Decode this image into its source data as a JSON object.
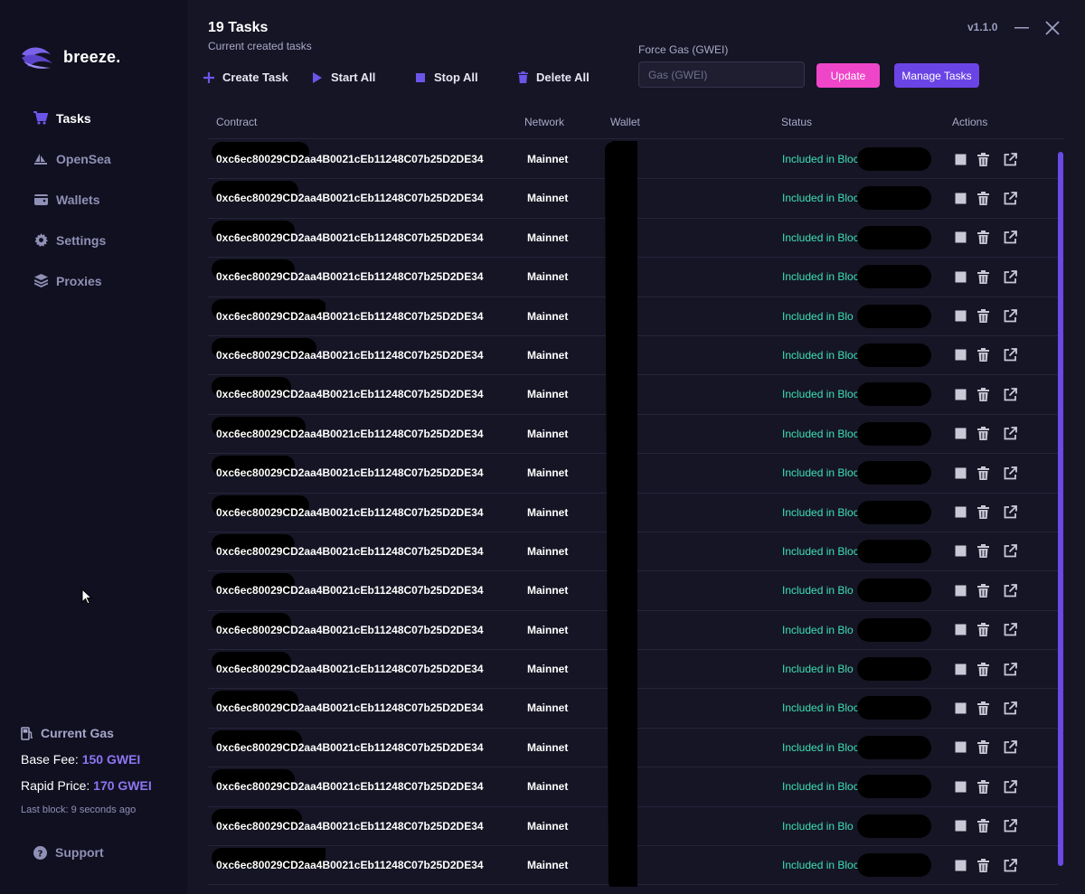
{
  "app": {
    "brand": "breeze.",
    "version": "v1.1.0"
  },
  "sidebar": {
    "items": [
      {
        "label": "Tasks",
        "icon": "cart-icon",
        "active": true
      },
      {
        "label": "OpenSea",
        "icon": "sailboat-icon",
        "active": false
      },
      {
        "label": "Wallets",
        "icon": "wallet-icon",
        "active": false
      },
      {
        "label": "Settings",
        "icon": "gear-icon",
        "active": false
      },
      {
        "label": "Proxies",
        "icon": "layers-icon",
        "active": false
      }
    ],
    "gas": {
      "title": "Current Gas",
      "base_fee_label": "Base Fee:",
      "base_fee_value": "150 GWEI",
      "rapid_label": "Rapid Price:",
      "rapid_value": "170 GWEI",
      "last_block": "Last block: 9 seconds ago"
    },
    "support_label": "Support"
  },
  "header": {
    "title": "19 Tasks",
    "subtitle": "Current created tasks"
  },
  "toolbar": {
    "create": "Create Task",
    "start": "Start All",
    "stop": "Stop All",
    "delete": "Delete All"
  },
  "gas_control": {
    "label": "Force Gas (GWEI)",
    "placeholder": "Gas (GWEI)",
    "value": "",
    "update_label": "Update",
    "manage_label": "Manage Tasks"
  },
  "table": {
    "columns": [
      "Contract",
      "Network",
      "Wallet",
      "Status",
      "Actions"
    ],
    "rows": [
      {
        "contract": "0xc6ec80029CD2aa4B0021cEb11248C07b25D2DE34",
        "network": "Mainnet",
        "status": "Included in Bloc"
      },
      {
        "contract": "0xc6ec80029CD2aa4B0021cEb11248C07b25D2DE34",
        "network": "Mainnet",
        "status": "Included in Bloc"
      },
      {
        "contract": "0xc6ec80029CD2aa4B0021cEb11248C07b25D2DE34",
        "network": "Mainnet",
        "status": "Included in Bloc"
      },
      {
        "contract": "0xc6ec80029CD2aa4B0021cEb11248C07b25D2DE34",
        "network": "Mainnet",
        "status": "Included in Bloc"
      },
      {
        "contract": "0xc6ec80029CD2aa4B0021cEb11248C07b25D2DE34",
        "network": "Mainnet",
        "status": "Included in Blo"
      },
      {
        "contract": "0xc6ec80029CD2aa4B0021cEb11248C07b25D2DE34",
        "network": "Mainnet",
        "status": "Included in Bloc"
      },
      {
        "contract": "0xc6ec80029CD2aa4B0021cEb11248C07b25D2DE34",
        "network": "Mainnet",
        "status": "Included in Bloc"
      },
      {
        "contract": "0xc6ec80029CD2aa4B0021cEb11248C07b25D2DE34",
        "network": "Mainnet",
        "status": "Included in Bloc"
      },
      {
        "contract": "0xc6ec80029CD2aa4B0021cEb11248C07b25D2DE34",
        "network": "Mainnet",
        "status": "Included in Block"
      },
      {
        "contract": "0xc6ec80029CD2aa4B0021cEb11248C07b25D2DE34",
        "network": "Mainnet",
        "status": "Included in Bloc"
      },
      {
        "contract": "0xc6ec80029CD2aa4B0021cEb11248C07b25D2DE34",
        "network": "Mainnet",
        "status": "Included in Bloc"
      },
      {
        "contract": "0xc6ec80029CD2aa4B0021cEb11248C07b25D2DE34",
        "network": "Mainnet",
        "status": "Included in Blo"
      },
      {
        "contract": "0xc6ec80029CD2aa4B0021cEb11248C07b25D2DE34",
        "network": "Mainnet",
        "status": "Included in Blo"
      },
      {
        "contract": "0xc6ec80029CD2aa4B0021cEb11248C07b25D2DE34",
        "network": "Mainnet",
        "status": "Included in Blo"
      },
      {
        "contract": "0xc6ec80029CD2aa4B0021cEb11248C07b25D2DE34",
        "network": "Mainnet",
        "status": "Included in Bloc"
      },
      {
        "contract": "0xc6ec80029CD2aa4B0021cEb11248C07b25D2DE34",
        "network": "Mainnet",
        "status": "Included in Bloc"
      },
      {
        "contract": "0xc6ec80029CD2aa4B0021cEb11248C07b25D2DE34",
        "network": "Mainnet",
        "status": "Included in Bloc"
      },
      {
        "contract": "0xc6ec80029CD2aa4B0021cEb11248C07b25D2DE34",
        "network": "Mainnet",
        "status": "Included in Blo"
      },
      {
        "contract": "0xc6ec80029CD2aa4B0021cEb11248C07b25D2DE34",
        "network": "Mainnet",
        "status": "Included in Bloc"
      }
    ]
  },
  "colors": {
    "accent": "#6b44e6",
    "update_button": "#ef45c8",
    "status_success": "#3ce0b4",
    "gas_value": "#8d76f2"
  }
}
